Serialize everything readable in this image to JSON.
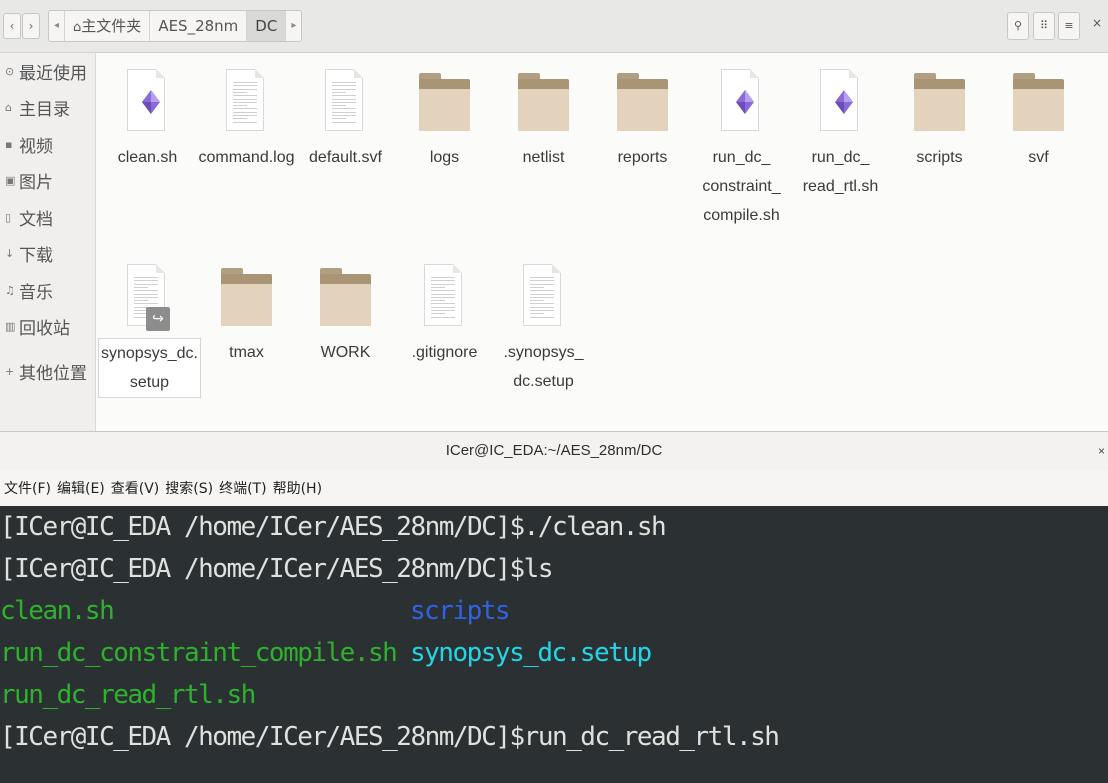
{
  "file_manager": {
    "breadcrumb": [
      "主文件夹",
      "AES_28nm",
      "DC"
    ],
    "sidebar": [
      {
        "icon": "clock-icon",
        "glyph": "⊙",
        "label": "最近使用"
      },
      {
        "icon": "home-icon",
        "glyph": "⌂",
        "label": "主目录"
      },
      {
        "icon": "video-icon",
        "glyph": "▪",
        "label": "视频"
      },
      {
        "icon": "image-icon",
        "glyph": "▣",
        "label": "图片"
      },
      {
        "icon": "document-icon",
        "glyph": "▯",
        "label": "文档"
      },
      {
        "icon": "download-icon",
        "glyph": "↓",
        "label": "下载"
      },
      {
        "icon": "music-icon",
        "glyph": "♫",
        "label": "音乐"
      },
      {
        "icon": "trash-icon",
        "glyph": "▥",
        "label": "回收站"
      },
      {
        "icon": "plus-icon",
        "glyph": "+",
        "label": "其他位置"
      }
    ],
    "files": [
      {
        "name": "clean.sh",
        "label_lines": [
          "clean.sh"
        ],
        "kind": "script"
      },
      {
        "name": "command.log",
        "label_lines": [
          "command.log"
        ],
        "kind": "text"
      },
      {
        "name": "default.svf",
        "label_lines": [
          "default.svf"
        ],
        "kind": "text"
      },
      {
        "name": "logs",
        "label_lines": [
          "logs"
        ],
        "kind": "folder"
      },
      {
        "name": "netlist",
        "label_lines": [
          "netlist"
        ],
        "kind": "folder"
      },
      {
        "name": "reports",
        "label_lines": [
          "reports"
        ],
        "kind": "folder"
      },
      {
        "name": "run_dc_constraint_compile.sh",
        "label_lines": [
          "run_dc_",
          "constraint_",
          "compile.sh"
        ],
        "kind": "script"
      },
      {
        "name": "run_dc_read_rtl.sh",
        "label_lines": [
          "run_dc_",
          "read_rtl.sh"
        ],
        "kind": "script"
      },
      {
        "name": "scripts",
        "label_lines": [
          "scripts"
        ],
        "kind": "folder"
      },
      {
        "name": "svf",
        "label_lines": [
          "svf"
        ],
        "kind": "folder"
      },
      {
        "name": "synopsys_dc.setup",
        "label_lines": [
          "synopsys_dc.",
          "setup"
        ],
        "kind": "link",
        "selected": true
      },
      {
        "name": "tmax",
        "label_lines": [
          "tmax"
        ],
        "kind": "folder"
      },
      {
        "name": "WORK",
        "label_lines": [
          "WORK"
        ],
        "kind": "folder"
      },
      {
        "name": ".gitignore",
        "label_lines": [
          ".gitignore"
        ],
        "kind": "text"
      },
      {
        "name": ".synopsys_dc.setup",
        "label_lines": [
          ".synopsys_",
          "dc.setup"
        ],
        "kind": "text"
      }
    ]
  },
  "terminal": {
    "title": "ICer@IC_EDA:~/AES_28nm/DC",
    "close": "×",
    "menu": [
      "文件(F)",
      "编辑(E)",
      "查看(V)",
      "搜索(S)",
      "终端(T)",
      "帮助(H)"
    ],
    "lines": [
      {
        "segments": [
          {
            "text": "[ICer@IC_EDA /home/ICer/AES_28nm/DC]$./clean.sh",
            "color": "default"
          }
        ]
      },
      {
        "segments": [
          {
            "text": "[ICer@IC_EDA /home/ICer/AES_28nm/DC]$ls",
            "color": "default"
          }
        ]
      },
      {
        "segments": [
          {
            "text": "clean.sh",
            "color": "green"
          }
        ],
        "col2": {
          "text": "scripts",
          "color": "blue"
        }
      },
      {
        "segments": [
          {
            "text": "run_dc_constraint_compile.sh",
            "color": "green"
          }
        ],
        "col2": {
          "text": "synopsys_dc.setup",
          "color": "cyan"
        }
      },
      {
        "segments": [
          {
            "text": "run_dc_read_rtl.sh",
            "color": "green"
          }
        ]
      },
      {
        "segments": [
          {
            "text": "[ICer@IC_EDA /home/ICer/AES_28nm/DC]$run_dc_read_rtl.sh",
            "color": "default"
          }
        ]
      }
    ]
  },
  "colors": {
    "folder": "#e3d3bc",
    "terminal_bg": "#2b3032",
    "green": "#2eb22e",
    "blue": "#2f63e3",
    "cyan": "#22d6e8"
  }
}
